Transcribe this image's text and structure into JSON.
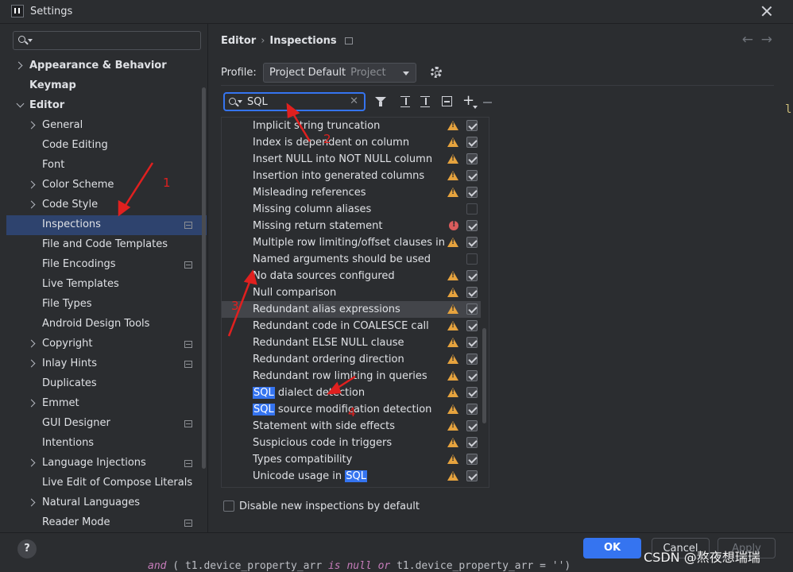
{
  "window": {
    "title": "Settings"
  },
  "sidebar": {
    "search_placeholder": "",
    "items": [
      {
        "label": "Appearance & Behavior",
        "bold": true,
        "indent": 0,
        "chevron": "right",
        "icon": false
      },
      {
        "label": "Keymap",
        "bold": true,
        "indent": 0,
        "chevron": "none",
        "icon": false
      },
      {
        "label": "Editor",
        "bold": true,
        "indent": 0,
        "chevron": "down",
        "icon": false
      },
      {
        "label": "General",
        "bold": false,
        "indent": 1,
        "chevron": "right",
        "icon": false
      },
      {
        "label": "Code Editing",
        "bold": false,
        "indent": 1,
        "chevron": "none",
        "icon": false
      },
      {
        "label": "Font",
        "bold": false,
        "indent": 1,
        "chevron": "none",
        "icon": false
      },
      {
        "label": "Color Scheme",
        "bold": false,
        "indent": 1,
        "chevron": "right",
        "icon": false
      },
      {
        "label": "Code Style",
        "bold": false,
        "indent": 1,
        "chevron": "right",
        "icon": false
      },
      {
        "label": "Inspections",
        "bold": false,
        "indent": 1,
        "chevron": "none",
        "icon": true,
        "selected": true
      },
      {
        "label": "File and Code Templates",
        "bold": false,
        "indent": 1,
        "chevron": "none",
        "icon": false
      },
      {
        "label": "File Encodings",
        "bold": false,
        "indent": 1,
        "chevron": "none",
        "icon": true
      },
      {
        "label": "Live Templates",
        "bold": false,
        "indent": 1,
        "chevron": "none",
        "icon": false
      },
      {
        "label": "File Types",
        "bold": false,
        "indent": 1,
        "chevron": "none",
        "icon": false
      },
      {
        "label": "Android Design Tools",
        "bold": false,
        "indent": 1,
        "chevron": "none",
        "icon": false
      },
      {
        "label": "Copyright",
        "bold": false,
        "indent": 1,
        "chevron": "right",
        "icon": true
      },
      {
        "label": "Inlay Hints",
        "bold": false,
        "indent": 1,
        "chevron": "right",
        "icon": true
      },
      {
        "label": "Duplicates",
        "bold": false,
        "indent": 1,
        "chevron": "none",
        "icon": false
      },
      {
        "label": "Emmet",
        "bold": false,
        "indent": 1,
        "chevron": "right",
        "icon": false
      },
      {
        "label": "GUI Designer",
        "bold": false,
        "indent": 1,
        "chevron": "none",
        "icon": true
      },
      {
        "label": "Intentions",
        "bold": false,
        "indent": 1,
        "chevron": "none",
        "icon": false
      },
      {
        "label": "Language Injections",
        "bold": false,
        "indent": 1,
        "chevron": "right",
        "icon": true
      },
      {
        "label": "Live Edit of Compose Literals",
        "bold": false,
        "indent": 1,
        "chevron": "none",
        "icon": false
      },
      {
        "label": "Natural Languages",
        "bold": false,
        "indent": 1,
        "chevron": "right",
        "icon": false
      },
      {
        "label": "Reader Mode",
        "bold": false,
        "indent": 1,
        "chevron": "none",
        "icon": true
      }
    ]
  },
  "header": {
    "breadcrumb_parent": "Editor",
    "breadcrumb_separator": "›",
    "breadcrumb_current": "Inspections"
  },
  "profile": {
    "label": "Profile:",
    "value": "Project Default",
    "scope": "Project"
  },
  "filter": {
    "value": "SQL",
    "clear_glyph": "✕"
  },
  "inspections": [
    {
      "pre": "",
      "hl": "",
      "post": "Implicit string truncation",
      "severity": "warning",
      "checked": true
    },
    {
      "pre": "",
      "hl": "",
      "post": "Index is dependent on column",
      "severity": "warning",
      "checked": true
    },
    {
      "pre": "",
      "hl": "",
      "post": "Insert NULL into NOT NULL column",
      "severity": "warning",
      "checked": true
    },
    {
      "pre": "",
      "hl": "",
      "post": "Insertion into generated columns",
      "severity": "warning",
      "checked": true
    },
    {
      "pre": "",
      "hl": "",
      "post": "Misleading references",
      "severity": "warning",
      "checked": true
    },
    {
      "pre": "",
      "hl": "",
      "post": "Missing column aliases",
      "severity": "none",
      "checked": false
    },
    {
      "pre": "",
      "hl": "",
      "post": "Missing return statement",
      "severity": "error",
      "checked": true
    },
    {
      "pre": "",
      "hl": "",
      "post": "Multiple row limiting/offset clauses in que",
      "severity": "warning",
      "checked": true
    },
    {
      "pre": "",
      "hl": "",
      "post": "Named arguments should be used",
      "severity": "none",
      "checked": false
    },
    {
      "pre": "",
      "hl": "",
      "post": "No data sources configured",
      "severity": "warning",
      "checked": true
    },
    {
      "pre": "",
      "hl": "",
      "post": "Null comparison",
      "severity": "warning",
      "checked": true
    },
    {
      "pre": "",
      "hl": "",
      "post": "Redundant alias expressions",
      "severity": "warning",
      "checked": true,
      "selected": true
    },
    {
      "pre": "",
      "hl": "",
      "post": "Redundant code in COALESCE call",
      "severity": "warning",
      "checked": true
    },
    {
      "pre": "",
      "hl": "",
      "post": "Redundant ELSE NULL clause",
      "severity": "warning",
      "checked": true
    },
    {
      "pre": "",
      "hl": "",
      "post": "Redundant ordering direction",
      "severity": "warning",
      "checked": true
    },
    {
      "pre": "",
      "hl": "",
      "post": "Redundant row limiting in queries",
      "severity": "warning",
      "checked": true
    },
    {
      "pre": "",
      "hl": "SQL",
      "post": " dialect detection",
      "severity": "warning",
      "checked": true
    },
    {
      "pre": "",
      "hl": "SQL",
      "post": " source modification detection",
      "severity": "warning",
      "checked": true
    },
    {
      "pre": "",
      "hl": "",
      "post": "Statement with side effects",
      "severity": "warning",
      "checked": true
    },
    {
      "pre": "",
      "hl": "",
      "post": "Suspicious code in triggers",
      "severity": "warning",
      "checked": true
    },
    {
      "pre": "",
      "hl": "",
      "post": "Types compatibility",
      "severity": "warning",
      "checked": true
    },
    {
      "pre": "Unicode usage in ",
      "hl": "SQL",
      "post": "",
      "severity": "warning",
      "checked": true
    }
  ],
  "options": {
    "disable_new_label": "Disable new inspections by default"
  },
  "footer": {
    "help_label": "?",
    "ok_label": "OK",
    "cancel_label": "Cancel",
    "apply_label": "Apply"
  },
  "background": {
    "editor_peek": "l",
    "code_kw1": "and",
    "code_rest": " ( t1.device_property_arr ",
    "code_kw2": "is null or",
    "code_rest2": " t1.device_property_arr = '')"
  },
  "annotations": {
    "labels": [
      "1",
      "2",
      "3",
      "4"
    ],
    "color": "#e0201f"
  },
  "watermark": "CSDN @熬夜想瑞瑞",
  "colors": {
    "accent": "#3574f0",
    "selection": "#2e436e",
    "warning": "#e6a33e",
    "error": "#db5c5c",
    "background": "#2b2d30"
  }
}
